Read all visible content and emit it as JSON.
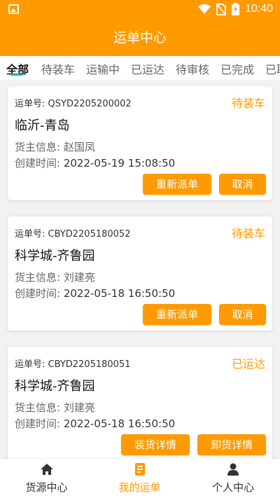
{
  "status_bar": {
    "time": "10:40"
  },
  "title": "运单中心",
  "tabs": [
    {
      "label": "全部"
    },
    {
      "label": "待装车"
    },
    {
      "label": "运输中"
    },
    {
      "label": "已运达"
    },
    {
      "label": "待审核"
    },
    {
      "label": "已完成"
    },
    {
      "label": "已取消"
    }
  ],
  "orders": [
    {
      "order_label": "运单号:",
      "order_no": "QSYD2205200002",
      "status": "待装车",
      "route": "临沂-青岛",
      "cargo_label": "货主信息:",
      "cargo_owner": "赵国凤",
      "created_label": "创建时间:",
      "created_time": "2022-05-19 15:08:50",
      "buttons": [
        "重新派单",
        "取消"
      ]
    },
    {
      "order_label": "运单号:",
      "order_no": "CBYD2205180052",
      "status": "待装车",
      "route": "科学城-齐鲁园",
      "cargo_label": "货主信息:",
      "cargo_owner": "刘建亮",
      "created_label": "创建时间:",
      "created_time": "2022-05-18 16:50:50",
      "buttons": [
        "重新派单",
        "取消"
      ]
    },
    {
      "order_label": "运单号:",
      "order_no": "CBYD2205180051",
      "status": "已运达",
      "route": "科学城-齐鲁园",
      "cargo_label": "货主信息:",
      "cargo_owner": "刘建亮",
      "created_label": "创建时间:",
      "created_time": "2022-05-18 16:50:50",
      "buttons": [
        "装货详情",
        "卸货详情"
      ]
    }
  ],
  "bottom_nav": [
    {
      "label": "货源中心",
      "icon": "home-icon"
    },
    {
      "label": "我的运单",
      "icon": "document-icon"
    },
    {
      "label": "个人中心",
      "icon": "person-icon"
    }
  ],
  "colors": {
    "accent": "#ff9a00",
    "tab_indicator": "#1bb5b5"
  }
}
